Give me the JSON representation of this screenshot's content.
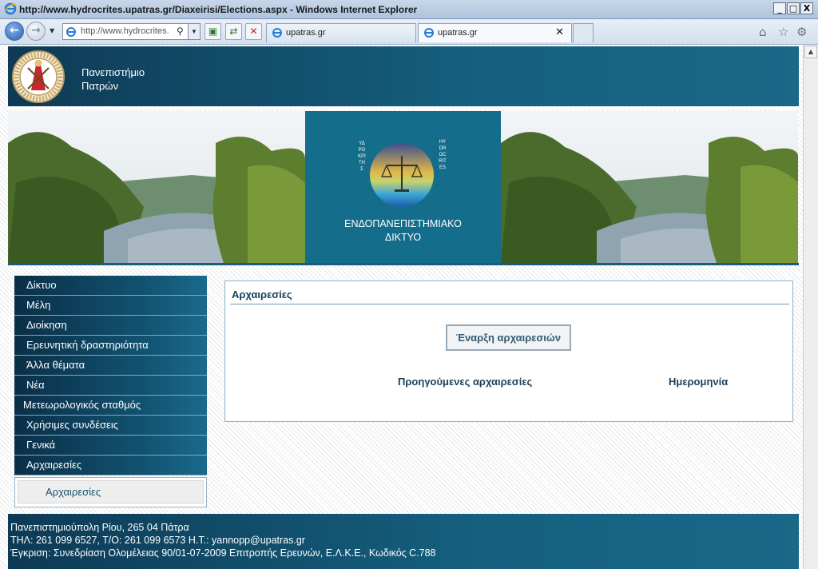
{
  "browser": {
    "window_title": "http://www.hydrocrites.upatras.gr/Diaxeirisi/Elections.aspx - Windows Internet Explorer",
    "address_text": "http://www.hydrocrites.",
    "tabs": [
      {
        "label": "upatras.gr",
        "active": false
      },
      {
        "label": "upatras.gr",
        "active": true
      }
    ],
    "window_buttons": {
      "minimize": "_",
      "maximize": "□",
      "close": "X"
    }
  },
  "header": {
    "university_line1": "Πανεπιστήμιο",
    "university_line2": "Πατρών"
  },
  "banner": {
    "caption_line1": "ΕΝΔΟΠΑΝΕΠΙΣΤΗΜΙΑΚΟ",
    "caption_line2": "ΔΙΚΤΥΟ",
    "logo_left_text": "ΥΔΡΟΚΡΙΤΗΣ",
    "logo_right_text": "HYDROCRITES"
  },
  "sidebar": {
    "items": [
      {
        "label": "Δίκτυο"
      },
      {
        "label": "Μέλη"
      },
      {
        "label": "Διοίκηση"
      },
      {
        "label": "Ερευνητική δραστηριότητα"
      },
      {
        "label": "Άλλα θέματα"
      },
      {
        "label": "Νέα"
      },
      {
        "label": "Μετεωρολογικός σταθμός"
      },
      {
        "label": "Χρήσιμες συνδέσεις"
      },
      {
        "label": "Γενικά"
      },
      {
        "label": "Αρχαιρεσίες"
      }
    ],
    "subitem": "Αρχαιρεσίες"
  },
  "main": {
    "title": "Αρχαιρεσίες",
    "start_button": "Έναρξη αρχαιρεσιών",
    "col_previous": "Προηγούμενες αρχαιρεσίες",
    "col_date": "Ημερομηνία"
  },
  "footer": {
    "line1": "Πανεπιστημιούπολη Ρίου, 265 04 Πάτρα",
    "line2": "ΤΗΛ: 261 099 6527, Τ/Ο: 261 099 6573 Η.Τ.:  yannopp@upatras.gr",
    "line3": "Έγκριση: Συνεδρίαση Ολομέλειας 90/01-07-2009 Επιτροπής Ερευνών, Ε.Λ.Κ.Ε., Κωδικός C.788"
  },
  "colors": {
    "header_dark": "#0e3a55",
    "header_light": "#1a6788",
    "banner_center": "#156d8c",
    "panel_border": "#8fb0c6"
  }
}
